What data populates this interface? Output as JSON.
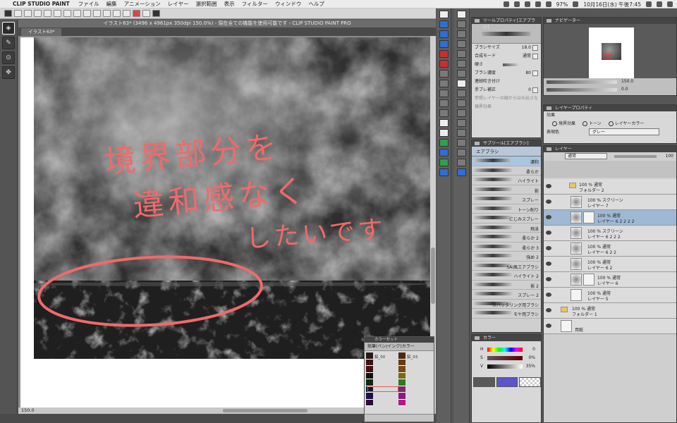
{
  "menubar": {
    "app_name": "CLIP STUDIO PAINT",
    "menus": [
      "ファイル",
      "編集",
      "アニメーション",
      "レイヤー",
      "選択範囲",
      "表示",
      "フィルター",
      "ウィンドウ",
      "ヘルプ"
    ],
    "battery": "97%",
    "clock": "10月16日(水) 午後7:45"
  },
  "window": {
    "title": "イラスト63* (3496 x 4961px 350dpi 150.0%) - 現在全ての機能を使用可能です - CLIP STUDIO PAINT PRO",
    "tab": "イラスト63*"
  },
  "canvas": {
    "handwritten_lines": [
      "境界部分を",
      "違和感なく",
      "したいです"
    ]
  },
  "statusbar": {
    "zoom": "150.0"
  },
  "colorset": {
    "title": "カラーセット",
    "set_name": "鉛筆(ペン/インク)カラー",
    "labels": [
      "鉛_00",
      "鉛_03"
    ]
  },
  "toolprop": {
    "title": "ツールプロパティ[エアブラシ]",
    "brush_size_label": "ブラシサイズ",
    "brush_size_value": "18.0",
    "blend_label": "合成モード",
    "blend_value": "通常",
    "hardness_label": "硬さ",
    "density_label": "ブラシ濃度",
    "density_value": "80",
    "continuous_label": "連続吹き付け",
    "stabilize_label": "手ブレ補正",
    "stabilize_value": "0",
    "ref_label": "参照レイヤーの線からはみ出さない",
    "border_label": "境界効果"
  },
  "subtool": {
    "title": "サブツール[エアブラシ]",
    "tab": "エアブラシ",
    "brushes": [
      "濃和",
      "柔らか",
      "ハイライト",
      "影",
      "スプレー",
      "トーン削り",
      "にじみスプレー",
      "飛沫",
      "柔らか 2",
      "柔らか 3",
      "強め 2",
      "SAI風エアブラシ",
      "ハイライト 2",
      "影 2",
      "スプレー 2",
      "スパッタリング用ブラシ",
      "モヤ用ブラシ"
    ]
  },
  "colorpanel": {
    "title": "カラー",
    "h_label": "H",
    "h_value": "0",
    "s_label": "S",
    "s_value": "0%",
    "v_label": "V",
    "v_value": "35%"
  },
  "navigator": {
    "title": "ナビゲーター",
    "zoom": "150.0",
    "rotation": "0.0"
  },
  "layerprop": {
    "title": "レイヤープロパティ",
    "effect_label": "効果",
    "effects": [
      "境界効果",
      "トーン",
      "レイヤーカラー"
    ],
    "expression_label": "表現色",
    "expression_value": "グレー"
  },
  "layers": {
    "title": "レイヤー",
    "blend": "通常",
    "opacity": "100",
    "rows": [
      {
        "mode": "100 % 通常",
        "name": "フォルダー 2",
        "kind": "folder"
      },
      {
        "mode": "100 % スクリーン",
        "name": "レイヤー 7",
        "kind": "layer"
      },
      {
        "mode": "100 % 通常",
        "name": "レイヤー 6 2 2 2 2",
        "kind": "layer"
      },
      {
        "mode": "100 % スクリーン",
        "name": "レイヤー 6 2 2 2",
        "kind": "layer"
      },
      {
        "mode": "100 % 通常",
        "name": "レイヤー 6 2 2",
        "kind": "layer"
      },
      {
        "mode": "100 % 通常",
        "name": "レイヤー 6 2",
        "kind": "layer"
      },
      {
        "mode": "100 % 通常",
        "name": "レイヤー 6",
        "kind": "layer"
      },
      {
        "mode": "100 % 通常",
        "name": "レイヤー 5",
        "kind": "layer"
      },
      {
        "mode": "100 % 通常",
        "name": "フォルダー 1",
        "kind": "folder"
      },
      {
        "mode": "",
        "name": "用紙",
        "kind": "paper"
      }
    ]
  },
  "colors": {
    "annotation": "#f06a6a",
    "selected_layer": "#9db9d3",
    "selected_brush": "#a9c6e0",
    "main_color": "#595959",
    "sub_color": "#5a55c8"
  }
}
